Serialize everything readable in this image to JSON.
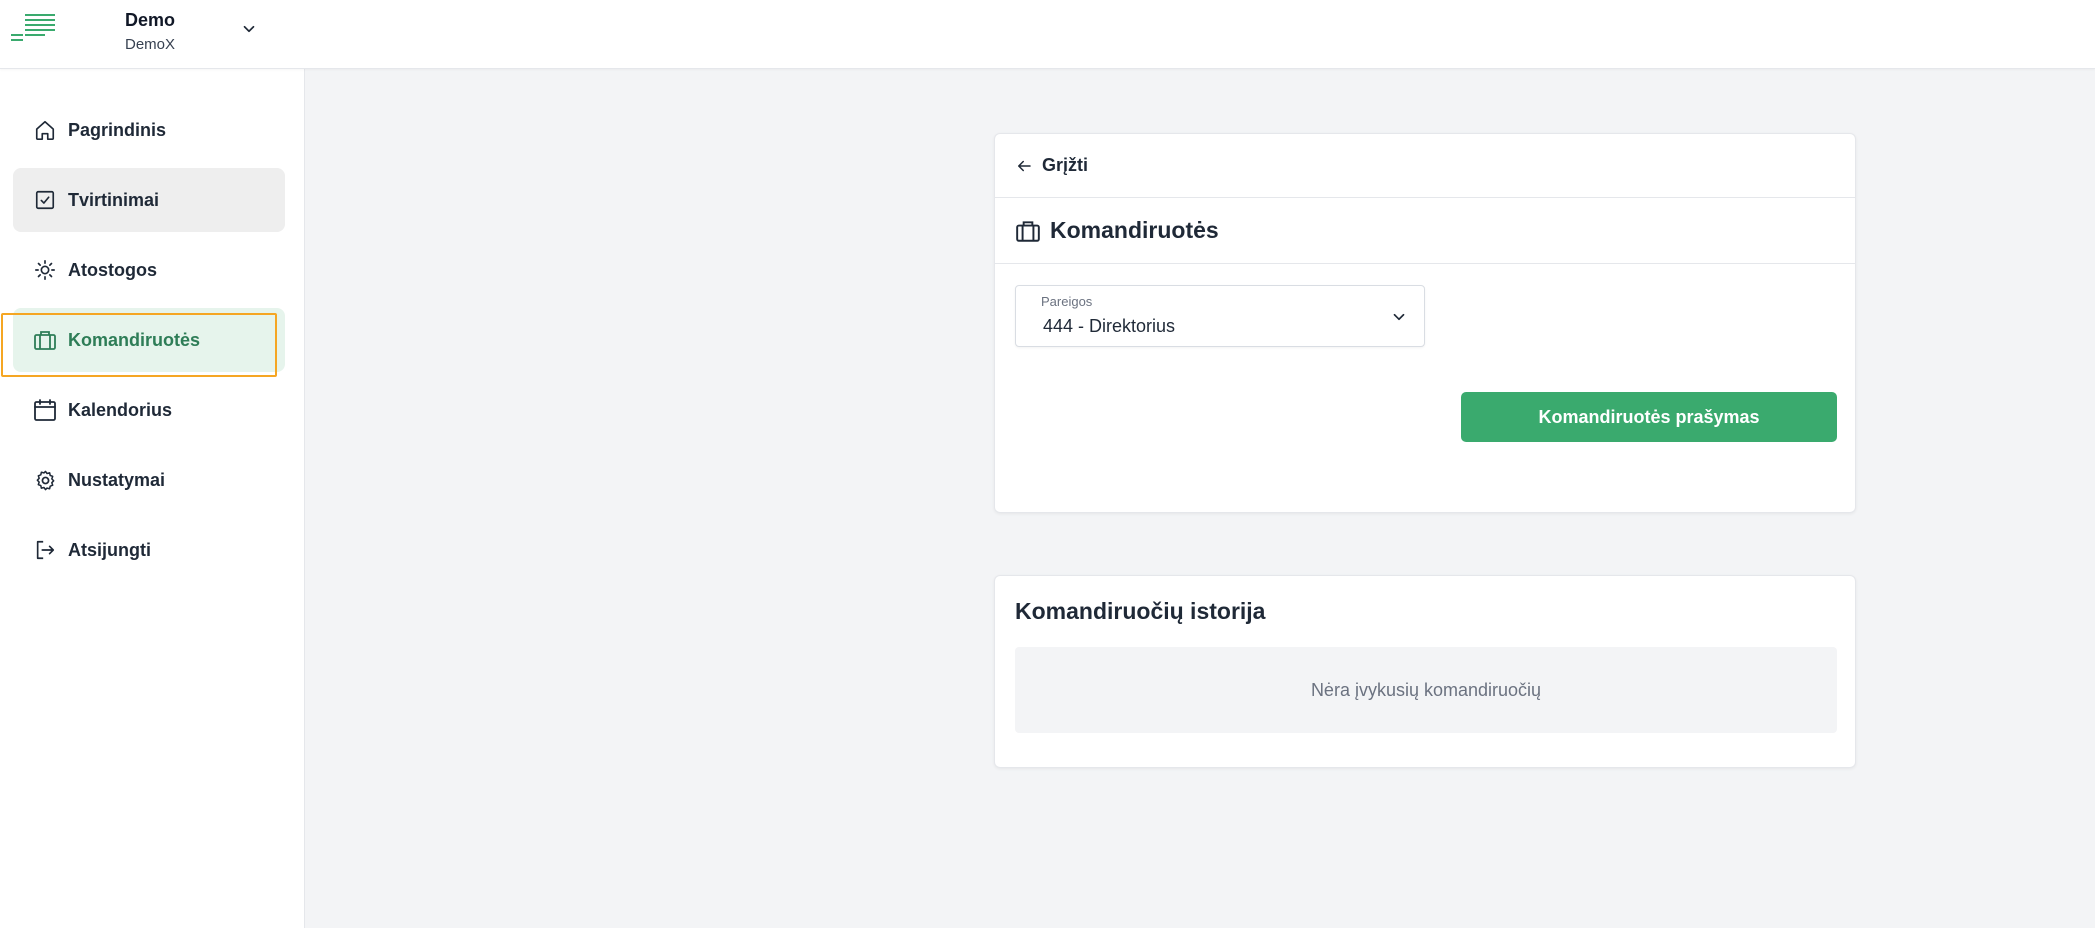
{
  "header": {
    "org_name": "Demo",
    "org_sub": "DemoX",
    "logo_icon": "menu-lines-logo",
    "chevron_icon": "chevron-down-icon"
  },
  "sidebar": {
    "items": [
      {
        "label": "Pagrindinis",
        "icon": "home-icon"
      },
      {
        "label": "Tvirtinimai",
        "icon": "checkbox-icon"
      },
      {
        "label": "Atostogos",
        "icon": "sun-icon"
      },
      {
        "label": "Komandiruotės",
        "icon": "briefcase-icon"
      },
      {
        "label": "Kalendorius",
        "icon": "calendar-icon"
      },
      {
        "label": "Nustatymai",
        "icon": "gear-icon"
      },
      {
        "label": "Atsijungti",
        "icon": "logout-icon"
      }
    ],
    "active_index": 3,
    "hover_index": 1
  },
  "main": {
    "back_label": "Grįžti",
    "section_title": "Komandiruotės",
    "field": {
      "label": "Pareigos",
      "value": "444 - Direktorius"
    },
    "request_button": "Komandiruotės prašymas",
    "history_title": "Komandiruočių istorija",
    "history_empty": "Nėra įvykusių komandiruočių"
  },
  "colors": {
    "accent": "#3aaa6e",
    "active_bg": "#e6f4ec",
    "active_text": "#2e7d57",
    "focus_ring": "#f5a623",
    "page_bg": "#f3f4f6"
  }
}
